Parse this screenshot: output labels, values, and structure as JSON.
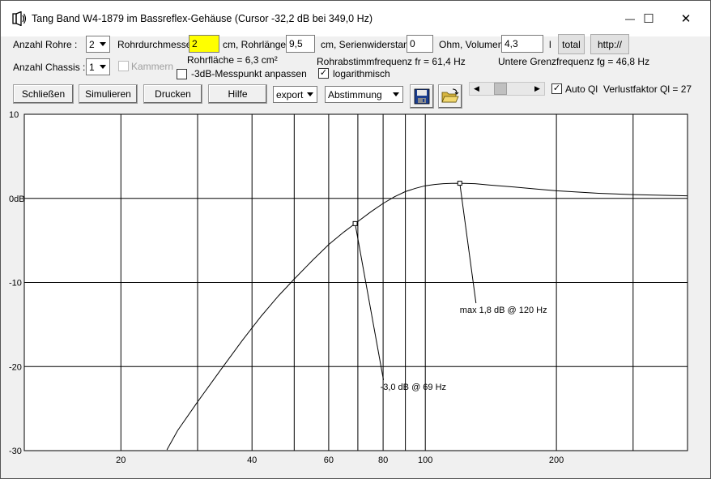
{
  "window": {
    "title": "Tang Band W4-1879 im Bassreflex-Gehäuse (Cursor -32,2 dB bei 349,0 Hz)",
    "min_glyph": "—",
    "max_glyph": "☐",
    "close_glyph": "✕"
  },
  "params": {
    "anzahl_rohre_label": "Anzahl Rohre :",
    "anzahl_rohre_value": "2",
    "rohrdurchmesser_label": "Rohrdurchmesser",
    "rohrdurchmesser_value": "2",
    "rohrlaenge_label": "cm, Rohrlänge",
    "rohrlaenge_value": "9,5",
    "serienwiderstand_label": "cm, Serienwiderstand",
    "serienwiderstand_value": "0",
    "volumen_label": "Ohm, Volumen",
    "volumen_value": "4,3",
    "volumen_unit": "l",
    "total_label": "total",
    "http_label": "http://",
    "anzahl_chassis_label": "Anzahl Chassis :",
    "anzahl_chassis_value": "1",
    "kammern_label": "Kammern",
    "rohrflaeche": "Rohrfläche = 6,3 cm²",
    "rohrabstimm": "Rohrabstimmfrequenz fr = 61,4 Hz",
    "grenzfrequenz": "Untere Grenzfrequenz fg = 46,8 Hz",
    "messpunkt_label": "-3dB-Messpunkt anpassen",
    "log_label": "logarithmisch",
    "check_mark": "✓"
  },
  "toolbar": {
    "schliessen": "Schließen",
    "simulieren": "Simulieren",
    "drucken": "Drucken",
    "hilfe": "Hilfe",
    "export_value": "export",
    "abstimmung_value": "Abstimmung",
    "auto_ql_label": "Auto Ql",
    "verlustfaktor": "Verlustfaktor Ql = 27",
    "scroll_left": "◀",
    "scroll_right": "▶"
  },
  "chart_data": {
    "type": "line",
    "title": "",
    "xlabel": "",
    "ylabel": "",
    "x_scale": "log",
    "xlim": [
      12,
      400
    ],
    "ylim": [
      -30,
      10
    ],
    "grid": true,
    "x_tick_labels": [
      "20",
      "40",
      "60",
      "80",
      "100",
      "200"
    ],
    "y_tick_labels": [
      "10",
      "0dB",
      "-10",
      "-20",
      "-30"
    ],
    "series": [
      {
        "x": [
          25.5,
          27,
          30,
          34,
          38,
          42,
          46,
          50,
          55,
          60,
          65,
          69,
          75,
          80,
          85,
          90,
          95,
          100,
          105,
          110,
          115,
          120,
          130,
          140,
          160,
          180,
          200,
          250,
          300,
          400
        ],
        "y": [
          -29.9,
          -27.6,
          -24.2,
          -20.3,
          -16.9,
          -14.0,
          -11.6,
          -9.6,
          -7.4,
          -5.5,
          -4.0,
          -3.0,
          -1.6,
          -0.6,
          0.2,
          0.8,
          1.2,
          1.5,
          1.65,
          1.75,
          1.78,
          1.8,
          1.75,
          1.6,
          1.35,
          1.1,
          0.9,
          0.6,
          0.45,
          0.3
        ]
      }
    ],
    "annotations": [
      {
        "text": "-3,0 dB @  69 Hz",
        "x": 69,
        "y": -3.0
      },
      {
        "text": "max 1,8 dB @ 120 Hz",
        "x": 120,
        "y": 1.8
      }
    ]
  }
}
